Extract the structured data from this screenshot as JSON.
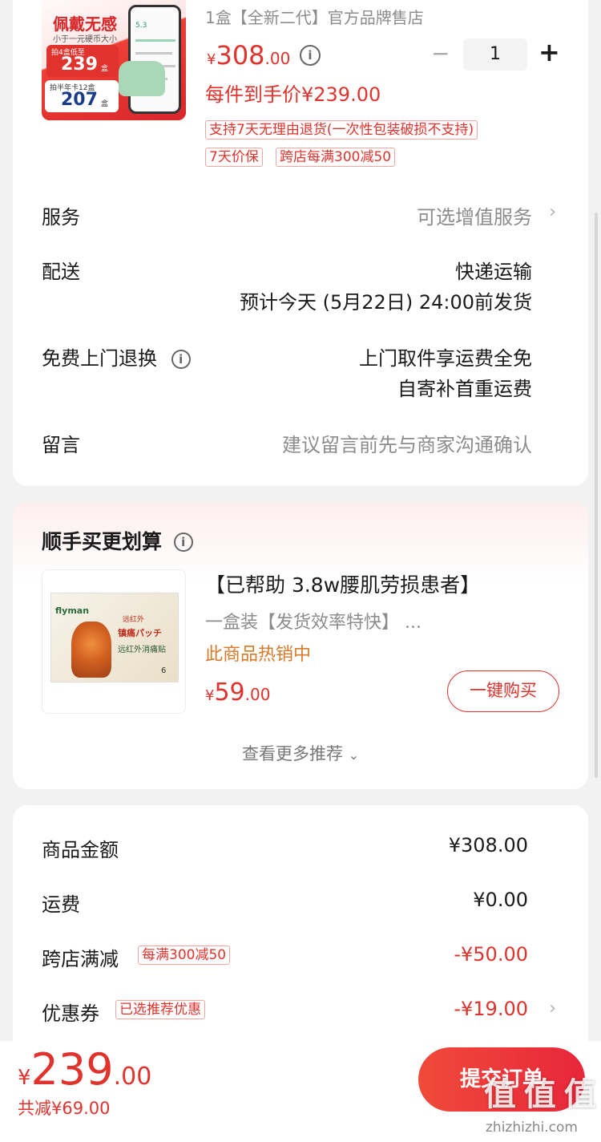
{
  "product": {
    "variant": "1盒【全新二代】官方品牌售店",
    "price_symbol": "¥",
    "price_int": "308",
    "price_dec": ".00",
    "quantity": "1",
    "minus": "−",
    "plus": "+",
    "final_price": "每件到手价¥239.00",
    "tags": [
      "支持7天无理由退货(一次性包装破损不支持)",
      "7天价保",
      "跨店每满300减50"
    ],
    "thumb": {
      "banner_top": "佩戴无感",
      "banner_sub": "小于一元硬币大小",
      "promo1_label": "拍4盒低至",
      "promo1_price": "239",
      "promo1_unit": "盒",
      "promo2_label": "拍半年卡12盒",
      "promo2_price": "207",
      "promo2_unit": "盒",
      "screen_value": "5.3"
    }
  },
  "service": {
    "label": "服务",
    "value": "可选增值服务"
  },
  "delivery": {
    "label": "配送",
    "method": "快递运输",
    "eta": "预计今天 (5月22日) 24:00前发货"
  },
  "returns": {
    "label": "免费上门退换",
    "line1": "上门取件享运费全免",
    "line2": "自寄补首重运费"
  },
  "message": {
    "label": "留言",
    "placeholder": "建议留言前先与商家沟通确认"
  },
  "recommend": {
    "title": "顺手买更划算",
    "item_title": "【已帮助 3.8w腰肌劳损患者】",
    "item_sub": "一盒装【发货效率特快】 ...",
    "item_hot": "此商品热销中",
    "item_price_symbol": "¥",
    "item_price_int": "59",
    "item_price_dec": ".00",
    "buy_button": "一键购买",
    "more": "查看更多推荐",
    "thumb_brand": "flyman",
    "thumb_text1": "远红外",
    "thumb_text2": "镇痛パッチ",
    "thumb_text3": "远红外消痛贴",
    "thumb_count": "6"
  },
  "summary": {
    "rows": [
      {
        "label": "商品金额",
        "tag": "",
        "value": "¥308.00"
      },
      {
        "label": "运费",
        "tag": "",
        "value": "¥0.00"
      },
      {
        "label": "跨店满减",
        "tag": "每满300减50",
        "value": "-¥50.00"
      },
      {
        "label": "优惠券",
        "tag": "已选推荐优惠",
        "value": "-¥19.00"
      }
    ]
  },
  "bottom": {
    "total_symbol": "¥",
    "total_int": "239",
    "total_dec": ".00",
    "discount": "共减¥69.00",
    "submit": "提交订单",
    "watermark": "值 值 值",
    "watermark_url": "zhizhizhi.com"
  },
  "colors": {
    "accent": "#e0332d",
    "button_gradient_start": "#f04a3a",
    "button_gradient_end": "#e8263a"
  }
}
